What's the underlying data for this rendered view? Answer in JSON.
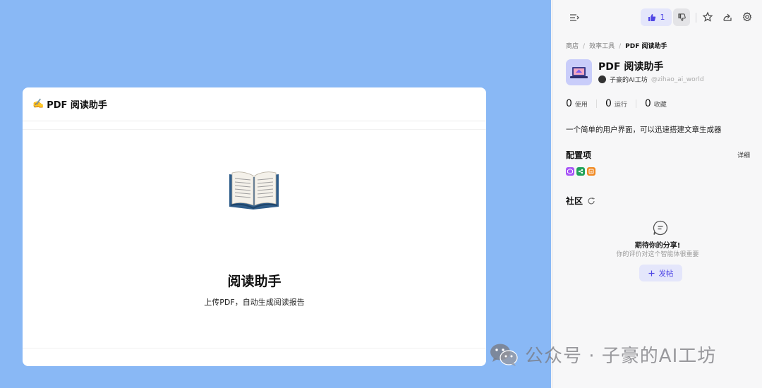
{
  "preview": {
    "card_title_icon": "✍️",
    "card_title": "PDF 阅读助手",
    "hero_icon": "open-book-icon",
    "app_title": "阅读助手",
    "app_desc": "上传PDF，自动生成阅读报告"
  },
  "toolbar": {
    "like_count": "1"
  },
  "breadcrumb": {
    "items": [
      "商店",
      "效率工具"
    ],
    "separator": "/",
    "current": "PDF 阅读助手"
  },
  "app": {
    "name": "PDF 阅读助手",
    "author": "子豪的AI工坊",
    "handle": "@zihao_ai_world"
  },
  "stats": [
    {
      "value": "0",
      "label": "使用"
    },
    {
      "value": "0",
      "label": "运行"
    },
    {
      "value": "0",
      "label": "收藏"
    }
  ],
  "description": "一个简单的用户界面，可以迅速搭建文章生成器",
  "config": {
    "title": "配置项",
    "detail_label": "详细",
    "plugins": [
      {
        "name": "purple-plugin-icon",
        "color": "#a855f7"
      },
      {
        "name": "green-plugin-icon",
        "color": "#22a35a"
      },
      {
        "name": "orange-plugin-icon",
        "color": "#f08a24"
      }
    ]
  },
  "community": {
    "title": "社区",
    "empty_title": "期待你的分享!",
    "empty_sub": "你的评价对这个智能体很重要",
    "post_label": "发帖"
  },
  "watermark": {
    "text": "公众号 · 子豪的AI工坊"
  },
  "colors": {
    "preview_bg": "#89b8f5",
    "accent": "#4f46e5",
    "accent_bg": "#e4e6fb"
  }
}
